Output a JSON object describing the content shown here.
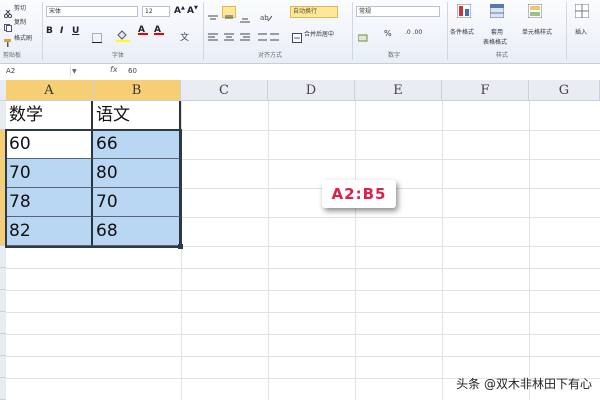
{
  "ribbon": {
    "clipboard": {
      "cut": "剪切",
      "copy": "复制",
      "format_painter": "格式刷",
      "group": "剪贴板"
    },
    "font": {
      "name": "宋体",
      "size": "12",
      "group": "字体"
    },
    "alignment": {
      "wrap_text": "自动换行",
      "merge_center": "合并后居中",
      "group": "对齐方式"
    },
    "number": {
      "format": "常规",
      "percent": "%",
      "group": "数字"
    },
    "styles": {
      "conditional": "条件格式",
      "table_format_1": "套用",
      "table_format_2": "表格格式",
      "cell_styles": "单元格样式",
      "group": "样式"
    },
    "cells": {
      "insert": "插入"
    }
  },
  "formula_bar": {
    "name_box": "A2",
    "fx": "fx",
    "value": "60"
  },
  "columns": [
    "A",
    "B",
    "C",
    "D",
    "E",
    "F",
    "G"
  ],
  "table": {
    "headers": [
      "数学",
      "语文"
    ],
    "rows": [
      [
        "60",
        "66"
      ],
      [
        "70",
        "80"
      ],
      [
        "78",
        "70"
      ],
      [
        "82",
        "68"
      ]
    ]
  },
  "callout": "A2:B5",
  "watermark": "头条 @双木非林田下有心",
  "colors": {
    "selection": "#b9d6f2",
    "header_selected": "#f6cf74",
    "callout_text": "#e0204a"
  }
}
